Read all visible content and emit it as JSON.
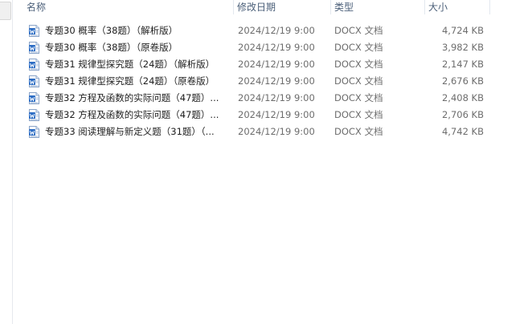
{
  "columns": {
    "name": "名称",
    "date": "修改日期",
    "type": "类型",
    "size": "大小"
  },
  "icon": {
    "name": "word-document-icon",
    "color": "#2b6cc4"
  },
  "files": [
    {
      "name": "专题30 概率（38题）（解析版）",
      "date": "2024/12/19 9:00",
      "type": "DOCX 文档",
      "size": "4,724 KB"
    },
    {
      "name": "专题30 概率（38题）（原卷版）",
      "date": "2024/12/19 9:00",
      "type": "DOCX 文档",
      "size": "3,982 KB"
    },
    {
      "name": "专题31 规律型探究题（24题）（解析版）",
      "date": "2024/12/19 9:00",
      "type": "DOCX 文档",
      "size": "2,147 KB"
    },
    {
      "name": "专题31 规律型探究题（24题）（原卷版）",
      "date": "2024/12/19 9:00",
      "type": "DOCX 文档",
      "size": "2,676 KB"
    },
    {
      "name": "专题32 方程及函数的实际问题（47题）...",
      "date": "2024/12/19 9:00",
      "type": "DOCX 文档",
      "size": "2,408 KB"
    },
    {
      "name": "专题32 方程及函数的实际问题（47题）...",
      "date": "2024/12/19 9:00",
      "type": "DOCX 文档",
      "size": "2,706 KB"
    },
    {
      "name": "专题33 阅读理解与新定义题（31题）（...",
      "date": "2024/12/19 9:00",
      "type": "DOCX 文档",
      "size": "4,742 KB"
    }
  ]
}
